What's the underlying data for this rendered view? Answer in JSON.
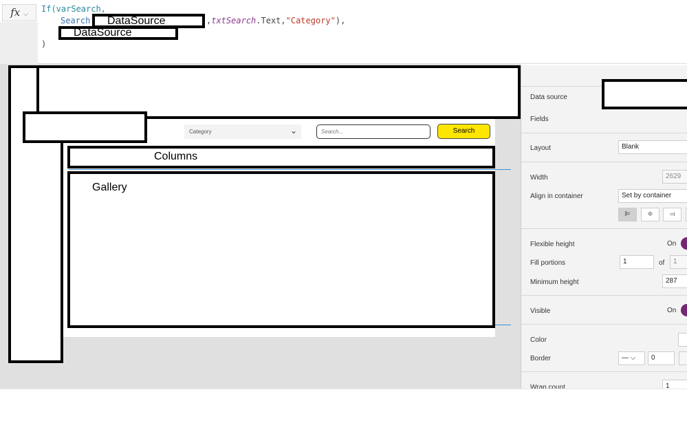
{
  "formula_bar": {
    "fx_label": "fx",
    "fx_chevron": "⌵",
    "line1_kw": "If(varSearch,",
    "line2_fn": "Search(",
    "line2_it": "txtSearch",
    "line2_rest": ".Text,",
    "line2_str": "\"Category\"",
    "line2_end": "),",
    "line2_comma": ",",
    "line3_end": ")",
    "redacted_1": "DataSource",
    "redacted_2": "DataSource"
  },
  "canvas": {
    "category_dropdown": "Category",
    "search_placeholder": "Search...",
    "search_button": "Search",
    "columns_label": "Columns",
    "gallery_label": "Gallery",
    "accent": "#ffe600"
  },
  "properties": {
    "data_source_label": "Data source",
    "fields_label": "Fields",
    "layout_label": "Layout",
    "layout_value": "Blank",
    "width_label": "Width",
    "width_value": "2629",
    "align_label": "Align in container",
    "align_value": "Set by container",
    "flex_height_label": "Flexible height",
    "flex_height_value": "On",
    "fill_portions_label": "Fill portions",
    "fill_portions_value": "1",
    "fill_of": "of",
    "fill_total": "1",
    "min_height_label": "Minimum height",
    "min_height_value": "287",
    "visible_label": "Visible",
    "visible_value": "On",
    "color_label": "Color",
    "border_label": "Border",
    "border_style": "—",
    "border_width": "0",
    "wrap_count_label": "Wrap count",
    "wrap_count_value": "1",
    "toggle_color": "#742774"
  }
}
